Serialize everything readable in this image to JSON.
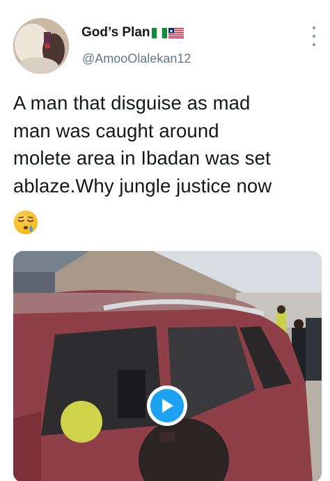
{
  "user": {
    "display_name": "God’s Plan",
    "handle": "@AmooOlalekan12",
    "flags": [
      "nigeria-flag",
      "liberia-flag"
    ]
  },
  "tweet": {
    "text": "A man that disguise as mad\nman was caught around\nmolete area in Ibadan was set\nablaze.Why jungle justice now",
    "emoji": "sleepy-face-emoji"
  },
  "menu": {
    "icon": "more-vertical-icon"
  },
  "media": {
    "type": "video",
    "play_icon": "play-icon"
  },
  "colors": {
    "accent": "#1da1f2",
    "text": "#14171a",
    "secondary_text": "#657786"
  }
}
